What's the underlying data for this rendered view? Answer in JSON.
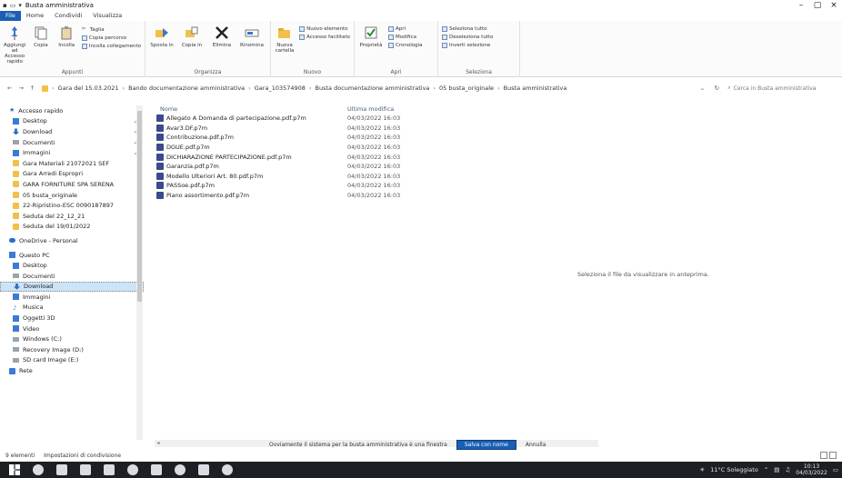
{
  "window": {
    "title": "Busta amministrativa",
    "controls": [
      "–",
      "▢",
      "×"
    ]
  },
  "ribbon_tabs": [
    "File",
    "Home",
    "Condividi",
    "Visualizza"
  ],
  "ribbon": {
    "groups": [
      {
        "name": "Appunti",
        "big": [
          "Aggiungi ad Accesso rapido",
          "Copia",
          "Incolla"
        ],
        "small": [
          "Taglia",
          "Copia percorso",
          "Incolla collegamento"
        ]
      },
      {
        "name": "Organizza",
        "big": [
          "Sposta in",
          "Copia in",
          "Elimina",
          "Rinomina"
        ],
        "small": []
      },
      {
        "name": "Nuovo",
        "big": [
          "Nuova cartella"
        ],
        "small": [
          "Nuovo elemento",
          "Accesso facilitato"
        ]
      },
      {
        "name": "Apri",
        "big": [
          "Proprietà"
        ],
        "small": [
          "Apri",
          "Modifica",
          "Cronologia"
        ]
      },
      {
        "name": "Seleziona",
        "big": [],
        "small": [
          "Seleziona tutto",
          "Deseleziona tutto",
          "Inverti selezione"
        ]
      }
    ]
  },
  "address": {
    "path": [
      "Gara del 15.03.2021",
      "Bando documentazione amministrativa",
      "Gara_103574908",
      "Busta documentazione amministrativa",
      "05 busta_originale",
      "Busta amministrativa"
    ],
    "search_placeholder": "Cerca in Busta amministrativa"
  },
  "nav": {
    "quick_access_label": "Accesso rapido",
    "quick_items": [
      "Desktop",
      "Download",
      "Documenti",
      "Immagini",
      "Gara Materiali 21072021 SEF",
      "Gara Arredi Espropri",
      "GARA FORNITURE SPA SERENA",
      "05 busta_originale",
      "22-Ripristino-ESC 0090187897",
      "Seduta del 22_12_21",
      "Seduta del 19/01/2022"
    ],
    "onedrive_label": "OneDrive - Personal",
    "pc_label": "Questo PC",
    "pc_items": [
      "Desktop",
      "Documenti",
      "Download",
      "Immagini",
      "Musica",
      "Oggetti 3D",
      "Video",
      "Windows (C:)",
      "Recovery Image (D:)",
      "SD card Image (E:)"
    ],
    "network_label": "Rete"
  },
  "files": {
    "columns": {
      "name": "Nome",
      "date": "Ultima modifica"
    },
    "rows": [
      {
        "name": "Allegato A Domanda di partecipazione.pdf.p7m",
        "date": "04/03/2022 16:03"
      },
      {
        "name": "Avar3.DF.p7m",
        "date": "04/03/2022 16:03"
      },
      {
        "name": "Contribuzione.pdf.p7m",
        "date": "04/03/2022 16:03"
      },
      {
        "name": "DGUE.pdf.p7m",
        "date": "04/03/2022 16:03"
      },
      {
        "name": "DICHIARAZIONE PARTECIPAZIONE.pdf.p7m",
        "date": "04/03/2022 16:03"
      },
      {
        "name": "Garanzia.pdf.p7m",
        "date": "04/03/2022 16:03"
      },
      {
        "name": "Modello Ulteriori Art. 80.pdf.p7m",
        "date": "04/03/2022 16:03"
      },
      {
        "name": "PASSoe.pdf.p7m",
        "date": "04/03/2022 16:03"
      },
      {
        "name": "Piano assortimento.pdf.p7m",
        "date": "04/03/2022 16:03"
      }
    ],
    "empty_preview_note": "Seleziona il file da visualizzare in anteprima."
  },
  "notice": {
    "text": "Ovviamente il sistema per la busta amministrativa è una finestra",
    "primary_button": "Salva con nome",
    "secondary_button": "Annulla"
  },
  "status": {
    "items_count": "9 elementi",
    "selection": "Impostazioni di condivisione"
  },
  "taskbar": {
    "weather": "11°C Soleggiato",
    "time": "10:13",
    "date": "04/03/2022"
  }
}
